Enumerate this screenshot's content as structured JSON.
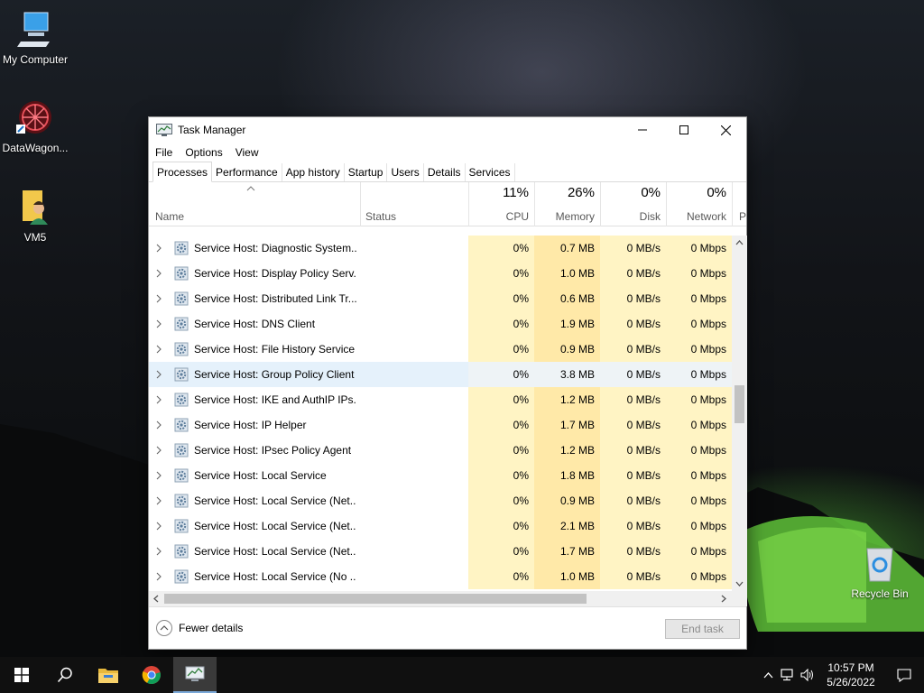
{
  "desktop": {
    "icons": [
      {
        "label": "My Computer",
        "icon": "computer-icon"
      },
      {
        "label": "DataWagon...",
        "icon": "datawagon-icon"
      },
      {
        "label": "VM5",
        "icon": "user-folder-icon"
      },
      {
        "label": "Recycle Bin",
        "icon": "recycle-bin-icon"
      }
    ]
  },
  "window": {
    "title": "Task Manager",
    "menu": [
      "File",
      "Options",
      "View"
    ],
    "tabs": [
      "Processes",
      "Performance",
      "App history",
      "Startup",
      "Users",
      "Details",
      "Services"
    ],
    "active_tab": "Processes",
    "columns": {
      "name": "Name",
      "status": "Status",
      "cpu": {
        "pct": "11%",
        "label": "CPU"
      },
      "memory": {
        "pct": "26%",
        "label": "Memory"
      },
      "disk": {
        "pct": "0%",
        "label": "Disk"
      },
      "network": {
        "pct": "0%",
        "label": "Network"
      },
      "next": "P"
    },
    "rows": [
      {
        "name": "Service Host: Diagnostic System...",
        "cpu": "0%",
        "memory": "0.7 MB",
        "disk": "0 MB/s",
        "network": "0 Mbps"
      },
      {
        "name": "Service Host: Display Policy Serv...",
        "cpu": "0%",
        "memory": "1.0 MB",
        "disk": "0 MB/s",
        "network": "0 Mbps"
      },
      {
        "name": "Service Host: Distributed Link Tr...",
        "cpu": "0%",
        "memory": "0.6 MB",
        "disk": "0 MB/s",
        "network": "0 Mbps"
      },
      {
        "name": "Service Host: DNS Client",
        "cpu": "0%",
        "memory": "1.9 MB",
        "disk": "0 MB/s",
        "network": "0 Mbps"
      },
      {
        "name": "Service Host: File History Service",
        "cpu": "0%",
        "memory": "0.9 MB",
        "disk": "0 MB/s",
        "network": "0 Mbps"
      },
      {
        "name": "Service Host: Group Policy Client",
        "cpu": "0%",
        "memory": "3.8 MB",
        "disk": "0 MB/s",
        "network": "0 Mbps"
      },
      {
        "name": "Service Host: IKE and AuthIP IPs...",
        "cpu": "0%",
        "memory": "1.2 MB",
        "disk": "0 MB/s",
        "network": "0 Mbps"
      },
      {
        "name": "Service Host: IP Helper",
        "cpu": "0%",
        "memory": "1.7 MB",
        "disk": "0 MB/s",
        "network": "0 Mbps"
      },
      {
        "name": "Service Host: IPsec Policy Agent",
        "cpu": "0%",
        "memory": "1.2 MB",
        "disk": "0 MB/s",
        "network": "0 Mbps"
      },
      {
        "name": "Service Host: Local Service",
        "cpu": "0%",
        "memory": "1.8 MB",
        "disk": "0 MB/s",
        "network": "0 Mbps"
      },
      {
        "name": "Service Host: Local Service (Net...",
        "cpu": "0%",
        "memory": "0.9 MB",
        "disk": "0 MB/s",
        "network": "0 Mbps"
      },
      {
        "name": "Service Host: Local Service (Net...",
        "cpu": "0%",
        "memory": "2.1 MB",
        "disk": "0 MB/s",
        "network": "0 Mbps"
      },
      {
        "name": "Service Host: Local Service (Net...",
        "cpu": "0%",
        "memory": "1.7 MB",
        "disk": "0 MB/s",
        "network": "0 Mbps"
      },
      {
        "name": "Service Host: Local Service (No ...",
        "cpu": "0%",
        "memory": "1.0 MB",
        "disk": "0 MB/s",
        "network": "0 Mbps"
      }
    ],
    "selected_row": "Service Host: Group Policy Client",
    "footer": {
      "fewer_details": "Fewer details",
      "end_task": "End task"
    }
  },
  "taskbar": {
    "apps": [
      "windows-start-icon",
      "search-icon",
      "file-explorer-icon",
      "chrome-icon",
      "task-manager-icon"
    ],
    "clock": {
      "time": "10:57 PM",
      "date": "5/26/2022"
    }
  },
  "colors": {
    "cpu_tint": "#fff4c4",
    "memory_tint": "#ffe9a8",
    "selected_row": "#e5f1fb",
    "taskbar": "#101010"
  }
}
